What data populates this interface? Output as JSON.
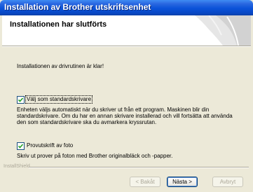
{
  "window": {
    "title": "Installation av Brother utskriftsenhet"
  },
  "header": {
    "title": "Installationen har slutförts"
  },
  "body": {
    "intro": "Installationen av drivrutinen är klar!",
    "default_printer": {
      "label": "Välj som standardskrivare",
      "checked": true,
      "description": "Enheten väljs automatiskt när du skriver ut från ett program. Maskinen blir din standardskrivare. Om du har en annan skrivare installerad och vill fortsätta att använda den som standardskrivare ska du avmarkera kryssrutan."
    },
    "test_print": {
      "label": "Provutskrift av foto",
      "checked": true,
      "description": "Skriv ut prover på foton med Brother originalbläck och -papper."
    }
  },
  "footer": {
    "brand": "InstallShield",
    "back_label": "< Bakåt",
    "next_label": "Nästa >",
    "cancel_label": "Avbryt"
  }
}
